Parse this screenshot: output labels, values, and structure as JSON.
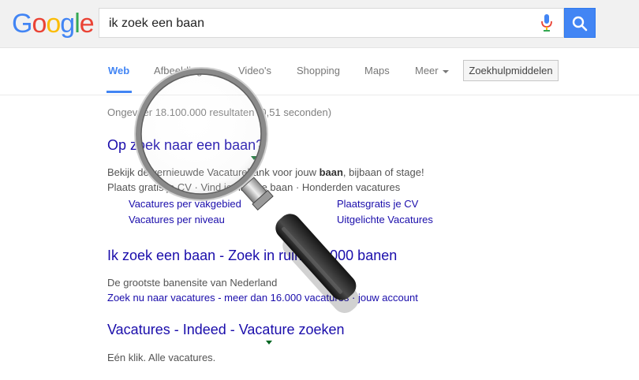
{
  "logo": {
    "letters": [
      "G",
      "o",
      "o",
      "g",
      "l",
      "e"
    ],
    "colors": [
      "#4285f4",
      "#ea4335",
      "#fbbc05",
      "#4285f4",
      "#34a853",
      "#ea4335"
    ]
  },
  "search": {
    "query": "ik zoek een baan"
  },
  "tabs": {
    "web": "Web",
    "images": "Afbeeldingen",
    "videos": "Video's",
    "shopping": "Shopping",
    "maps": "Maps",
    "more": "Meer",
    "tools": "Zoekhulpmiddelen"
  },
  "stats": "Ongeveer 18.100.000 resultaten (0,51 seconden)",
  "results": [
    {
      "title": "Op zoek naar een baan?",
      "snippet_prefix": "Bekijk de vernieuwde Vacaturebank voor jouw ",
      "snippet_bold": "baan",
      "snippet_suffix": ", bijbaan of stage!",
      "snippet_line2": "Plaats gratis je CV · Vind je nieuwe baan · Honderden vacatures",
      "sitelinks": [
        "Vacatures per vakgebied",
        "Plaatsgratis je CV",
        "Vacatures per niveau",
        "Uitgelichte Vacatures"
      ]
    },
    {
      "title": "Ik zoek een baan - Zoek in ruim 17.000 banen",
      "snippet": "De grootste banensite van Nederland",
      "link": "Zoek nu naar vacatures - meer dan 16.000 vacatures · jouw account"
    },
    {
      "title": "Vacatures - Indeed - Vacature zoeken",
      "snippet": "Eén klik. Alle vacatures."
    }
  ]
}
